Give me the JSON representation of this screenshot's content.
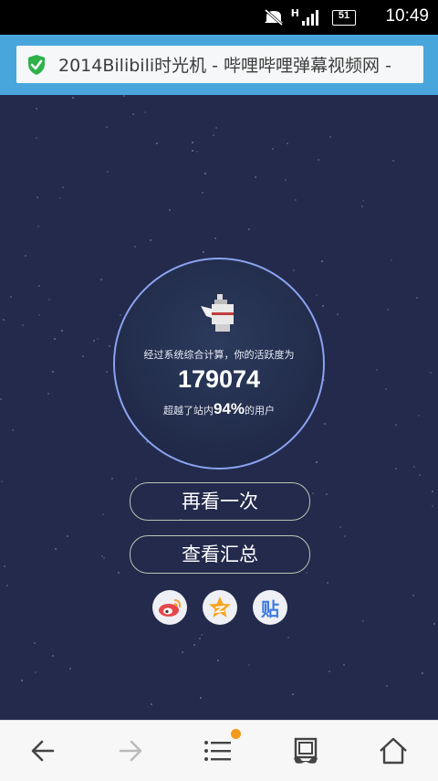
{
  "status_bar": {
    "time": "10:49",
    "network": "H",
    "battery": "51",
    "icons": [
      "mute-icon",
      "signal-icon",
      "battery-icon"
    ]
  },
  "url_bar": {
    "page_title": "2014Bilibili时光机 - 哔哩哔哩弹幕视频网 -",
    "secure_icon": "shield-check-icon"
  },
  "result_card": {
    "line1": "经过系统综合计算，你的活跃度为",
    "score": "179074",
    "line2_prefix": "超越了站内",
    "percent": "94%",
    "line2_suffix": "的用户"
  },
  "buttons": {
    "replay": "再看一次",
    "summary": "查看汇总"
  },
  "share": {
    "weibo_icon": "weibo-icon",
    "qzone_icon": "qzone-star-icon",
    "tieba_label": "贴"
  },
  "nav_bar": {
    "items": [
      "back-icon",
      "forward-icon",
      "menu-icon",
      "tabs-icon",
      "home-icon"
    ]
  },
  "colors": {
    "background": "#22294a",
    "url_bar": "#49a6dd",
    "circle_border": "#8aa3f0",
    "button_border": "#b9c6b4",
    "notification_dot": "#f39a1d"
  }
}
